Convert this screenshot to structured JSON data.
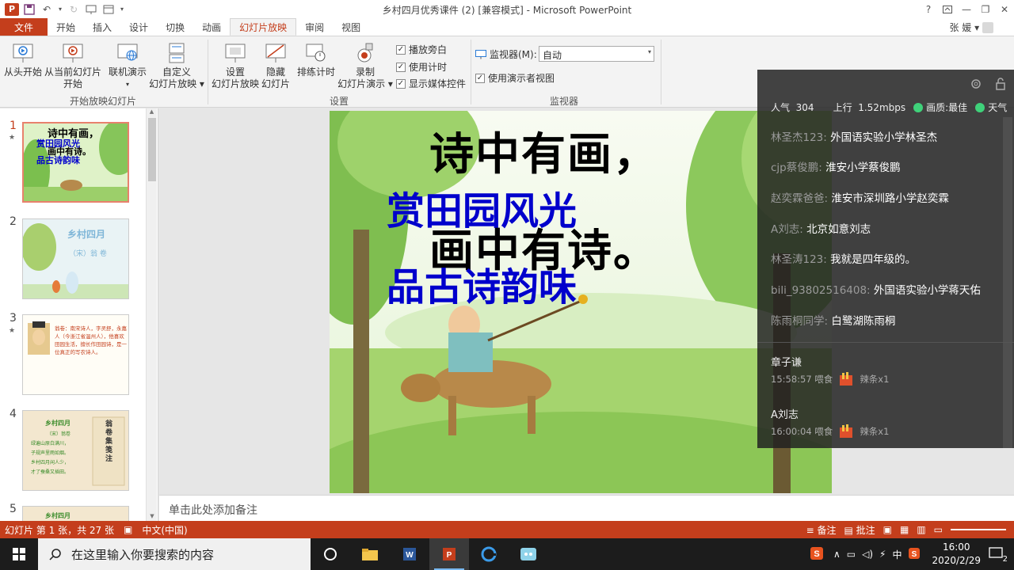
{
  "window": {
    "title": "乡村四月优秀课件 (2) [兼容模式] - Microsoft PowerPoint",
    "help": "?",
    "user": "张 媛"
  },
  "tabs": [
    {
      "label": "文件"
    },
    {
      "label": "开始"
    },
    {
      "label": "插入"
    },
    {
      "label": "设计"
    },
    {
      "label": "切换"
    },
    {
      "label": "动画"
    },
    {
      "label": "幻灯片放映"
    },
    {
      "label": "审阅"
    },
    {
      "label": "视图"
    }
  ],
  "ribbon": {
    "from_start": "从头开始",
    "from_current_l1": "从当前幻灯片",
    "from_current_l2": "开始",
    "online_present": "联机演示",
    "custom_l1": "自定义",
    "custom_l2": "幻灯片放映",
    "group_start": "开始放映幻灯片",
    "setup_l1": "设置",
    "setup_l2": "幻灯片放映",
    "hide_l1": "隐藏",
    "hide_l2": "幻灯片",
    "rehearse": "排练计时",
    "record_l1": "录制",
    "record_l2": "幻灯片演示",
    "play_narration": "播放旁白",
    "use_timings": "使用计时",
    "show_media": "显示媒体控件",
    "group_setup": "设置",
    "monitor_label": "监视器(M):",
    "monitor_value": "自动",
    "presenter_view": "使用演示者视图",
    "group_monitor": "监视器"
  },
  "thumbnails": [
    {
      "num": "1",
      "star": "★",
      "t1": "诗中有画，",
      "t2": "赏田园风光",
      "t3": "画中有诗。",
      "t4": "品古诗韵味"
    },
    {
      "num": "2",
      "t1": "乡村四月",
      "t2": "（宋）翁 卷"
    },
    {
      "num": "3",
      "star": "★",
      "t1": "翁卷：南宋诗人，字灵舒，永嘉人（今浙江省温州人），他喜欢田园生活，擅长作田园诗，是一位真正的写农诗人。"
    },
    {
      "num": "4",
      "t1": "乡村四月",
      "t2": "（宋）翁卷",
      "t3": "绿遍山原白满川，",
      "t4": "子规声里雨如烟。",
      "t5": "乡村四月闲人少，",
      "t6": "才了蚕桑又插田。",
      "t7": "翁卷集笺注"
    },
    {
      "num": "5",
      "t1": "乡村四月"
    }
  ],
  "slide": {
    "line1": "诗中有画，",
    "line2": "赏田园风光",
    "line3": "画中有诗。",
    "line4": "品古诗韵味"
  },
  "notes_placeholder": "单击此处添加备注",
  "status": {
    "slide_info": "幻灯片 第 1 张，共 27 张",
    "language": "中文(中国)",
    "notes": "备注",
    "comments": "批注"
  },
  "taskbar": {
    "search_placeholder": "在这里输入你要搜索的内容",
    "time": "16:00",
    "date": "2020/2/29",
    "ime": "中",
    "notif_count": "2"
  },
  "overlay": {
    "popularity_label": "人气",
    "popularity": "304",
    "upload_label": "上行",
    "upload": "1.52mbps",
    "quality_label": "画质:",
    "quality": "最佳",
    "extra": "天气",
    "chats": [
      {
        "name": "林圣杰123:",
        "msg": "外国语实验小学林圣杰"
      },
      {
        "name": "cjp蔡俊鹏:",
        "msg": "淮安小学蔡俊鹏"
      },
      {
        "name": "赵奕霖爸爸:",
        "msg": "淮安市深圳路小学赵奕霖"
      },
      {
        "name": "A刘志:",
        "msg": "北京如意刘志"
      },
      {
        "name": "林圣涛123:",
        "msg": "我就是四年级的。"
      },
      {
        "name": "bili_93802516408:",
        "msg": "外国语实验小学蒋天佑"
      },
      {
        "name": "陈雨桐同学:",
        "msg": "白鹭湖陈雨桐"
      }
    ],
    "gifts": [
      {
        "user": "章子谦",
        "time": "15:58:57 喂食",
        "gift": "辣条x1"
      },
      {
        "user": "A刘志",
        "time": "16:00:04 喂食",
        "gift": "辣条x1"
      }
    ]
  },
  "colors": {
    "accent": "#c43e1c",
    "slide_title": "#0000cc"
  }
}
